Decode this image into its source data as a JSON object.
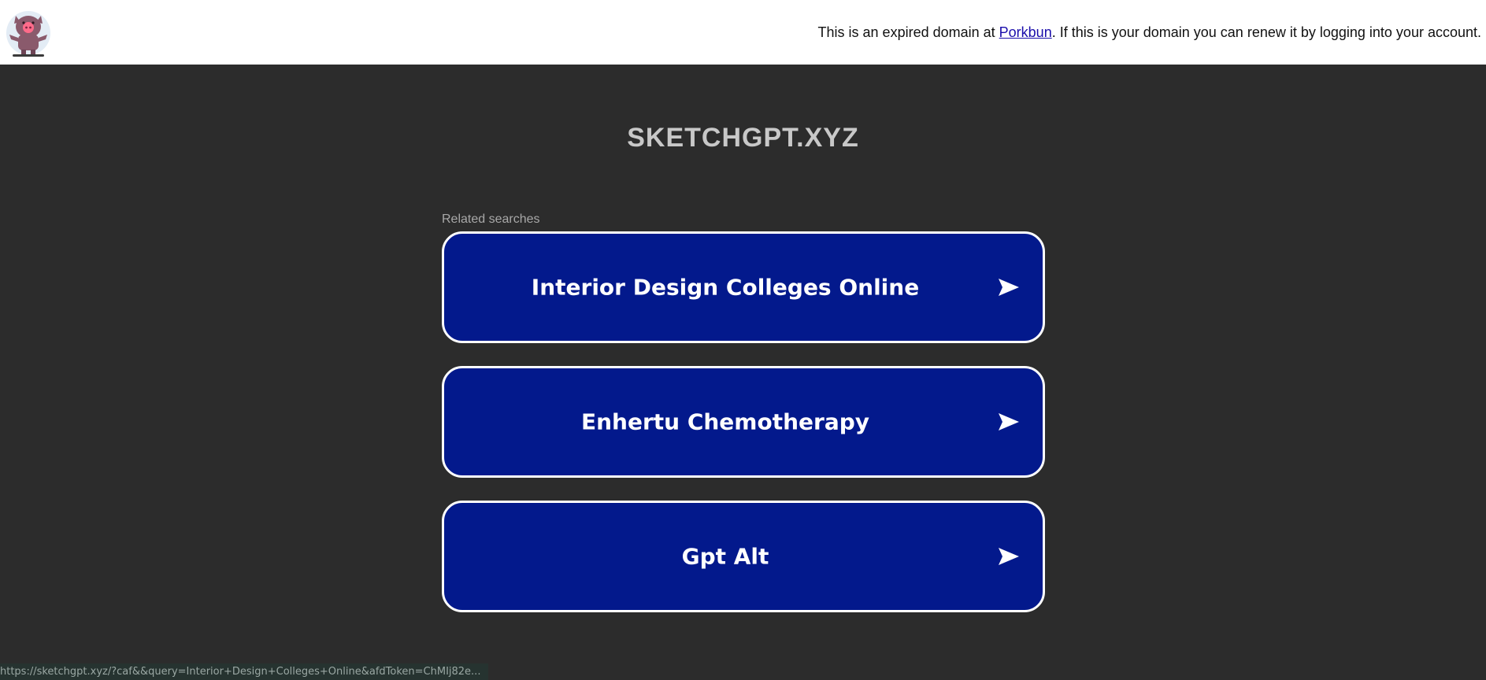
{
  "header": {
    "logo_icon": "pig-mascot-icon",
    "notice_before": "This is an expired domain at ",
    "notice_link": "Porkbun",
    "notice_after": ". If this is your domain you can renew it by logging into your account."
  },
  "main": {
    "site_title": "SKETCHGPT.XYZ",
    "related_label": "Related searches",
    "searches": [
      {
        "label": "Interior Design Colleges Online",
        "icon": "arrow-right-icon"
      },
      {
        "label": "Enhertu Chemotherapy",
        "icon": "arrow-right-icon"
      },
      {
        "label": "Gpt Alt",
        "icon": "arrow-right-icon"
      }
    ]
  },
  "status_bar": {
    "url": "https://sketchgpt.xyz/?caf&&query=Interior+Design+Colleges+Online&afdToken=ChMIj82e..."
  },
  "colors": {
    "background": "#2c2c2c",
    "button": "#03198c",
    "title": "#c8c8c8",
    "link": "#1a0dab"
  }
}
